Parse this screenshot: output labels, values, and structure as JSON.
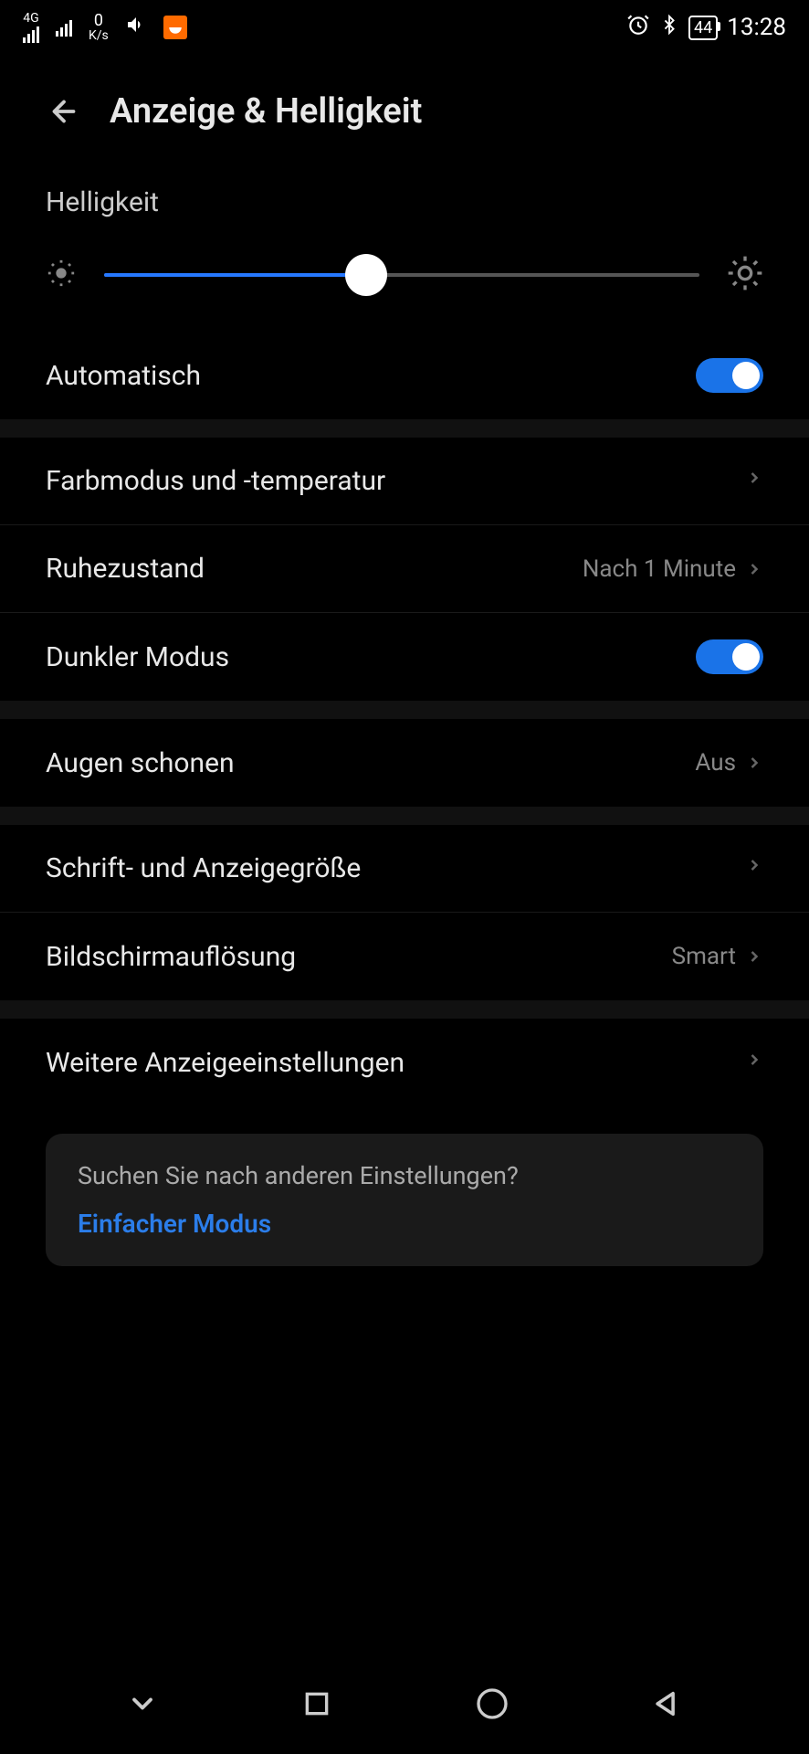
{
  "status": {
    "network_type": "4G",
    "speed_value": "0",
    "speed_unit": "K/s",
    "battery": "44",
    "time": "13:28"
  },
  "header": {
    "title": "Anzeige & Helligkeit"
  },
  "brightness": {
    "label": "Helligkeit",
    "value_percent": 44
  },
  "rows": {
    "auto": {
      "label": "Automatisch",
      "on": true
    },
    "color_mode": {
      "label": "Farbmodus und -temperatur"
    },
    "sleep": {
      "label": "Ruhezustand",
      "value": "Nach 1 Minute"
    },
    "dark_mode": {
      "label": "Dunkler Modus",
      "on": true
    },
    "eye_comfort": {
      "label": "Augen schonen",
      "value": "Aus"
    },
    "font_size": {
      "label": "Schrift- und Anzeigegröße"
    },
    "resolution": {
      "label": "Bildschirmauflösung",
      "value": "Smart"
    },
    "more": {
      "label": "Weitere Anzeigeeinstellungen"
    }
  },
  "suggestion": {
    "title": "Suchen Sie nach anderen Einstellungen?",
    "link": "Einfacher Modus"
  }
}
